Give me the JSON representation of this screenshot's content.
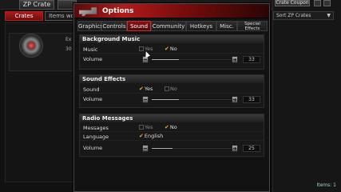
{
  "topbar": {
    "zp_crate": "ZP Crate",
    "crate_coupon": "Crate Coupon"
  },
  "bgtabs": {
    "crates": "Crates",
    "items": "Items wo"
  },
  "item": {
    "line1": "Ex",
    "line2": "30"
  },
  "sort": {
    "label": "Sort ZP Crates",
    "arrow": "▼"
  },
  "items_count": "Items: 1",
  "dialog": {
    "title": "Options",
    "tabs": [
      "Graphics",
      "Controls",
      "Sound",
      "Community",
      "Hotkeys",
      "Misc.",
      "Special Effects"
    ],
    "active_tab": "Sound",
    "background_music": {
      "header": "Background Music",
      "music_label": "Music",
      "yes": "Yes",
      "no": "No",
      "music_value": "No",
      "volume_label": "Volume",
      "volume": 33
    },
    "sound_effects": {
      "header": "Sound Effects",
      "sound_label": "Sound",
      "yes": "Yes",
      "no": "No",
      "sound_value": "Yes",
      "volume_label": "Volume",
      "volume": 33
    },
    "radio_messages": {
      "header": "Radio Messages",
      "messages_label": "Messages",
      "yes": "Yes",
      "no": "No",
      "messages_value": "No",
      "language_label": "Language",
      "language_option": "English",
      "volume_label": "Volume",
      "volume": 25
    }
  },
  "colors": {
    "accent": "#b21b1b",
    "check": "#f6a623"
  }
}
